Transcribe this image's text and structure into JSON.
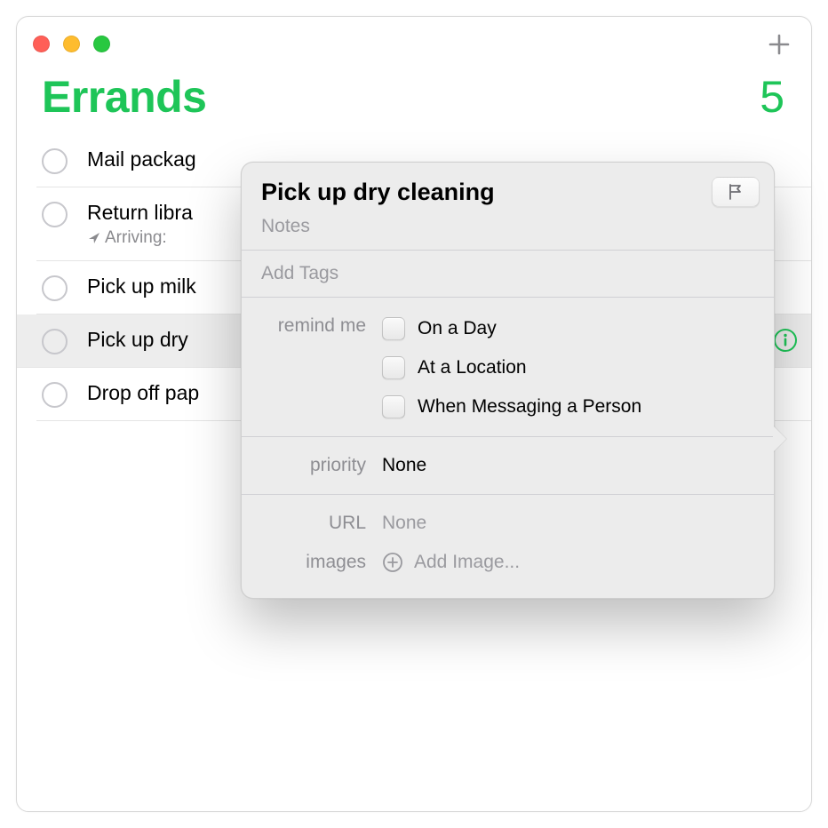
{
  "list": {
    "title": "Errands",
    "count": 5,
    "accent_color": "#1ec558"
  },
  "reminders": {
    "items": [
      {
        "title": "Mail packag"
      },
      {
        "title": "Return libra",
        "sub_prefix": "Arriving:",
        "sub_rest": ""
      },
      {
        "title": "Pick up milk"
      },
      {
        "title": "Pick up dry"
      },
      {
        "title": "Drop off pap"
      }
    ]
  },
  "popover": {
    "title": "Pick up dry cleaning",
    "notes_placeholder": "Notes",
    "tags_placeholder": "Add Tags",
    "remind_label": "remind me",
    "options": {
      "on_day": "On a Day",
      "at_location": "At a Location",
      "when_messaging": "When Messaging a Person"
    },
    "priority_label": "priority",
    "priority_value": "None",
    "url_label": "URL",
    "url_value": "None",
    "images_label": "images",
    "add_image_label": "Add Image..."
  }
}
